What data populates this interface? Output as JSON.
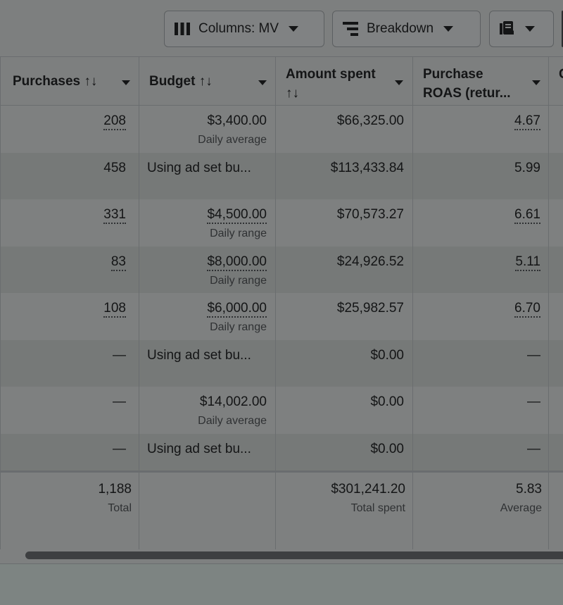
{
  "toolbar": {
    "columns_label": "Columns: MV",
    "breakdown_label": "Breakdown",
    "icons": {
      "columns": "columns-icon",
      "breakdown": "breakdown-icon",
      "export": "reports-icon"
    }
  },
  "table": {
    "headers": [
      {
        "label": "Purchases ↑↓"
      },
      {
        "label": "Budget ↑↓"
      },
      {
        "line1": "Amount spent",
        "line2": "↑↓"
      },
      {
        "line1": "Purchase",
        "line2": "ROAS (retur..."
      }
    ],
    "rows": [
      {
        "purchases": "208",
        "budget": "$3,400.00",
        "budget_sub": "Daily average",
        "spent": "$66,325.00",
        "roas": "4.67"
      },
      {
        "purchases": "458",
        "budget": "Using ad set bu...",
        "budget_sub": "",
        "spent": "$113,433.84",
        "roas": "5.99"
      },
      {
        "purchases": "331",
        "budget": "$4,500.00",
        "budget_sub": "Daily range",
        "spent": "$70,573.27",
        "roas": "6.61"
      },
      {
        "purchases": "83",
        "budget": "$8,000.00",
        "budget_sub": "Daily range",
        "spent": "$24,926.52",
        "roas": "5.11"
      },
      {
        "purchases": "108",
        "budget": "$6,000.00",
        "budget_sub": "Daily range",
        "spent": "$25,982.57",
        "roas": "6.70"
      },
      {
        "purchases": "—",
        "budget": "Using ad set bu...",
        "budget_sub": "",
        "spent": "$0.00",
        "roas": "—"
      },
      {
        "purchases": "—",
        "budget": "$14,002.00",
        "budget_sub": "Daily average",
        "spent": "$0.00",
        "roas": "—"
      },
      {
        "purchases": "—",
        "budget": "Using ad set bu...",
        "budget_sub": "",
        "spent": "$0.00",
        "roas": "—"
      }
    ],
    "totals": {
      "purchases": "1,188",
      "purchases_sub": "Total",
      "spent": "$301,241.20",
      "spent_sub": "Total spent",
      "roas": "5.83",
      "roas_sub": "Average"
    }
  }
}
